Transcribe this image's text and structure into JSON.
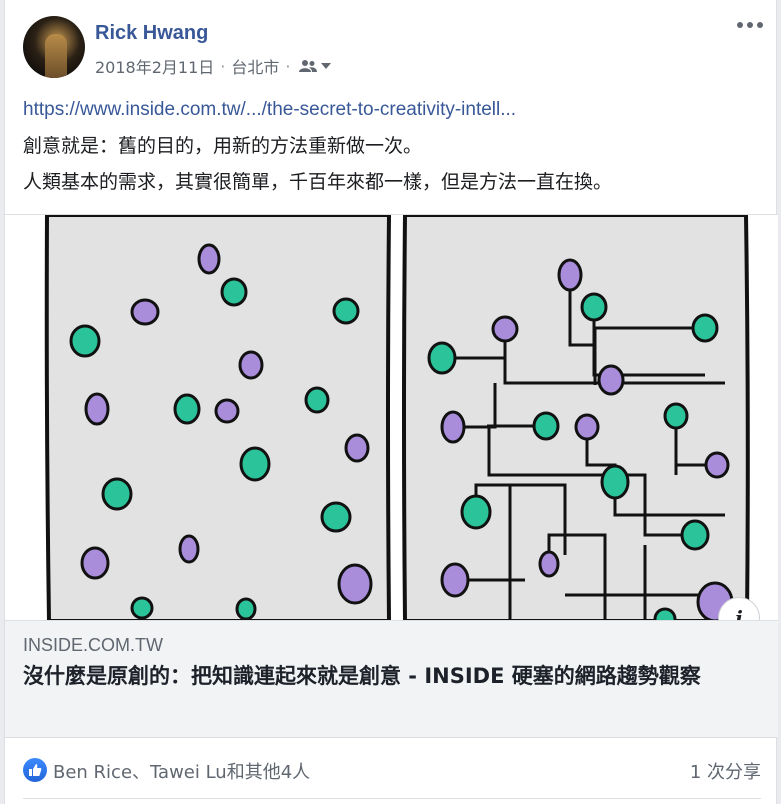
{
  "post": {
    "author": "Rick Hwang",
    "date": "2018年2月11日",
    "separator": "·",
    "location": "台北市",
    "link_url_text": "https://www.inside.com.tw/.../the-secret-to-creativity-intell...",
    "text_line_1": "創意就是：舊的目的，用新的方法重新做一次。",
    "text_line_2": "人類基本的需求，其實很簡單，千百年來都一樣，但是方法一直在換。"
  },
  "link_preview": {
    "domain": "INSIDE.COM.TW",
    "title": "沒什麼是原創的：把知識連起來就是創意 - INSIDE 硬塞的網路趨勢觀察",
    "info_label": "i"
  },
  "footer": {
    "reactors": "Ben Rice、Tawei Lu和其他4人",
    "shares": "1 次分享"
  },
  "icons": {
    "more": "more-horizontal-icon",
    "audience": "friends-icon",
    "dropdown": "caret-down-icon",
    "like": "thumbs-up-icon",
    "info": "info-icon"
  },
  "colors": {
    "author": "#385898",
    "link": "#385898",
    "dot_green": "#2bc49a",
    "dot_purple": "#a98ddb",
    "panel_bg": "#e2e2e2",
    "like_badge": "#2d72e6"
  }
}
